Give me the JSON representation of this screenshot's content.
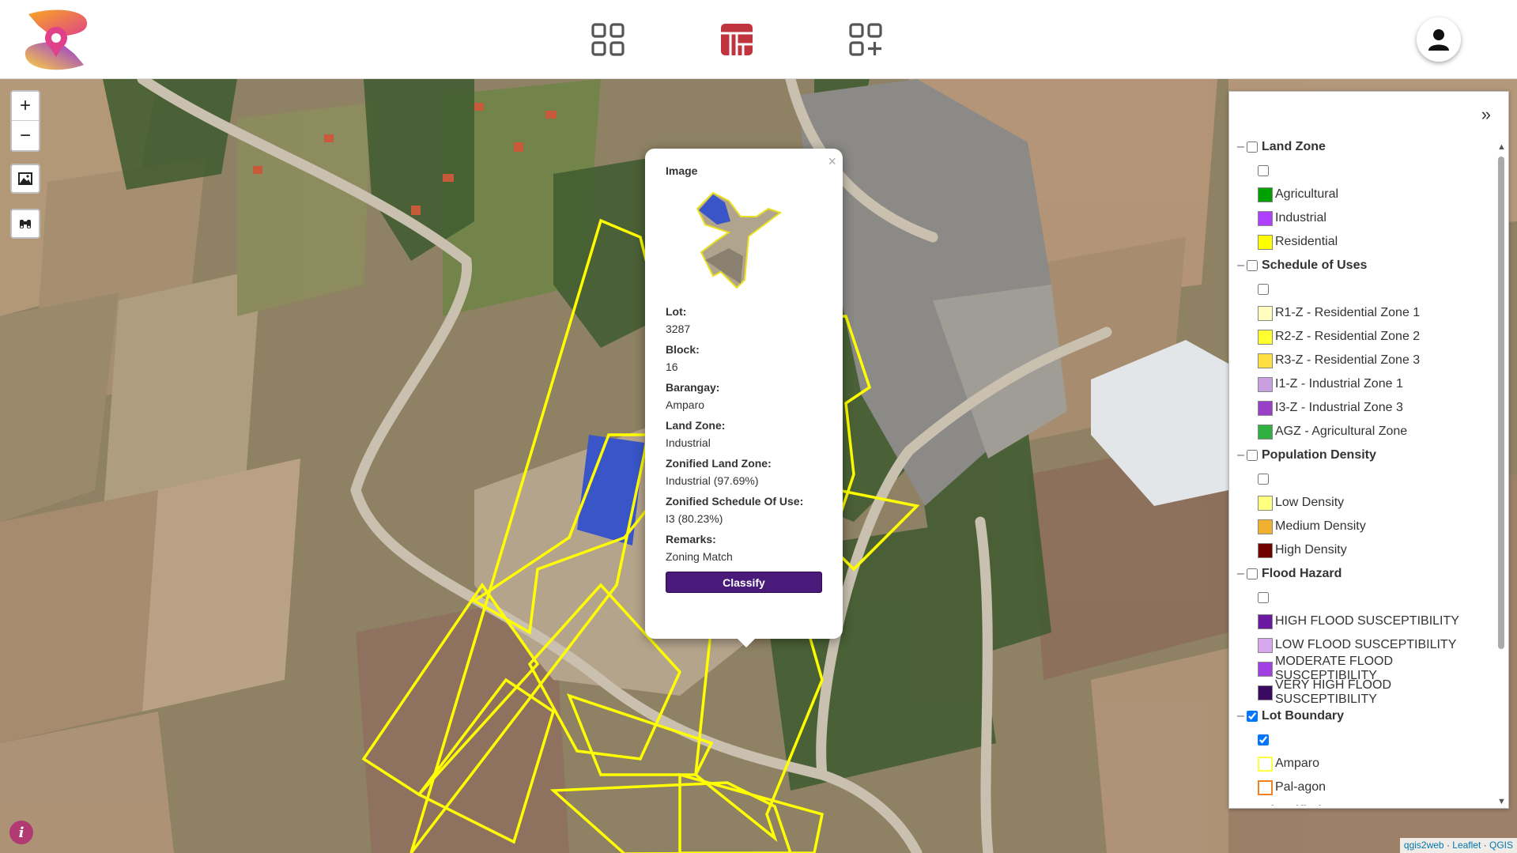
{
  "header": {
    "nav": [
      {
        "icon": "dashboard-grid-icon"
      },
      {
        "icon": "map-layout-icon",
        "active": true
      },
      {
        "icon": "add-grid-icon"
      }
    ],
    "profile_icon": "user-icon",
    "accent_color": "#c0343f"
  },
  "map_controls": {
    "zoom_in": "+",
    "zoom_out": "−",
    "info": "i"
  },
  "popup": {
    "close": "×",
    "title": "Image",
    "fields": [
      {
        "label": "Lot:",
        "value": "3287"
      },
      {
        "label": "Block:",
        "value": "16"
      },
      {
        "label": "Barangay:",
        "value": "Amparo"
      },
      {
        "label": "Land Zone:",
        "value": "Industrial"
      },
      {
        "label": "Zonified Land Zone:",
        "value": "Industrial (97.69%)"
      },
      {
        "label": "Zonified Schedule Of Use:",
        "value": "I3 (80.23%)"
      },
      {
        "label": "Remarks:",
        "value": "Zoning Match"
      }
    ],
    "button": "Classify",
    "button_color": "#4a1a7a"
  },
  "layers": {
    "collapse": "»",
    "groups": [
      {
        "name": "Land Zone",
        "checked": false,
        "items": [
          {
            "label": "Agricultural",
            "color": "#00a000"
          },
          {
            "label": "Industrial",
            "color": "#b040ff"
          },
          {
            "label": "Residential",
            "color": "#ffff00"
          }
        ]
      },
      {
        "name": "Schedule of Uses",
        "checked": false,
        "items": [
          {
            "label": "R1-Z - Residential Zone 1",
            "color": "#fffcc0"
          },
          {
            "label": "R2-Z - Residential Zone 2",
            "color": "#ffff30"
          },
          {
            "label": "R3-Z - Residential Zone 3",
            "color": "#ffe040"
          },
          {
            "label": "I1-Z - Industrial Zone 1",
            "color": "#c8a0e0"
          },
          {
            "label": "I3-Z - Industrial Zone 3",
            "color": "#9a40c8"
          },
          {
            "label": "AGZ - Agricultural Zone",
            "color": "#30b040"
          }
        ]
      },
      {
        "name": "Population Density",
        "checked": false,
        "items": [
          {
            "label": "Low Density",
            "color": "#ffff80"
          },
          {
            "label": "Medium Density",
            "color": "#f0b030"
          },
          {
            "label": "High Density",
            "color": "#700000"
          }
        ]
      },
      {
        "name": "Flood Hazard",
        "checked": false,
        "items": [
          {
            "label": "HIGH FLOOD SUSCEPTIBILITY",
            "color": "#6a1aa0"
          },
          {
            "label": "LOW FLOOD SUSCEPTIBILITY",
            "color": "#d8a8ee"
          },
          {
            "label": "MODERATE FLOOD SUSCEPTIBILITY",
            "color": "#a040e0"
          },
          {
            "label": "VERY HIGH FLOOD SUSCEPTIBILITY",
            "color": "#3a0a60"
          }
        ]
      },
      {
        "name": "Lot Boundary",
        "checked": true,
        "items": [
          {
            "label": "Amparo",
            "color": "#ffff40",
            "outline": true
          },
          {
            "label": "Pal-agon",
            "color": "#f08020",
            "outline": true
          }
        ]
      },
      {
        "name": "Classified Lot",
        "checked": false,
        "items": []
      }
    ]
  },
  "attribution": [
    "qgis2web",
    "Leaflet",
    "QGIS"
  ]
}
